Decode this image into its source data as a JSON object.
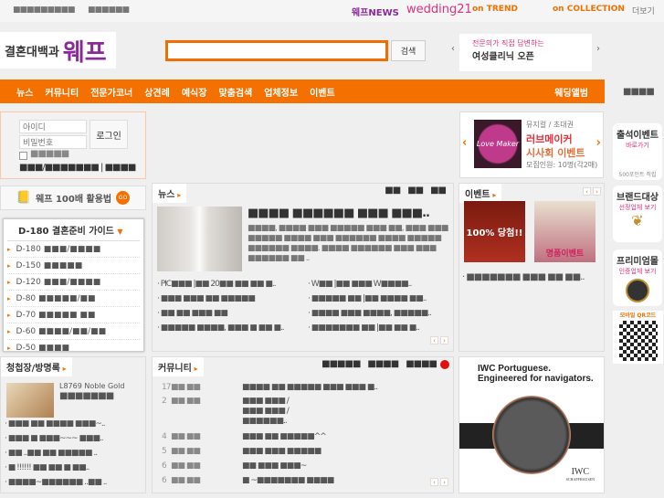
{
  "topbar": {
    "left1": "■■■■■■■■■",
    "left2": "■■■■■■",
    "links": [
      "웨프NEWS",
      "wedding21",
      "on TREND",
      "on COLLECTION"
    ],
    "more": "더보기"
  },
  "logo": {
    "text": "결혼대백과",
    "brand": "웨프"
  },
  "search": {
    "value": "",
    "button": "검색"
  },
  "banner": {
    "line1": "전문의가 직접 답변하는",
    "line2": "여성클리닉 오픈"
  },
  "nav": {
    "items": [
      "뉴스",
      "커뮤니티",
      "전문가코너",
      "상견례",
      "예식장",
      "맞춤검색",
      "업체정보",
      "이벤트"
    ],
    "album": "웨딩앨범",
    "right": "■■■■"
  },
  "login": {
    "id_placeholder": "아이디",
    "pw_placeholder": "비밀번호",
    "button": "로그인",
    "remember": "■■■■■",
    "links": "■■■/■■■■■■■ | ■■■■"
  },
  "tips": {
    "label": "웨프 100배 활용법",
    "go": "GO"
  },
  "guide": {
    "title": "D-180 결혼준비 가이드",
    "items": [
      "D-180 ■■■/■■■■",
      "D-150 ■■■■■",
      "D-120 ■■■/■■■■",
      "D-80 ■■■■■/■■",
      "D-70 ■■■■■ ■■",
      "D-60 ■■■■/■■/■■",
      "D-50 ■■■■"
    ]
  },
  "news": {
    "title": "뉴스",
    "tabs": [
      "■■",
      "■■",
      "■■"
    ],
    "headline": "■■■■ ■■■■■■ ■■■ ■■■..",
    "summary": "■■■■, ■■■■ ■■■ ■■■■■ ■■■ ■■, ■■■ ■■■ ■■■■■ ■■■■ ■■■ ■■■■■■ ■■■■ ■■■■■ ■■■■■■ ■■■■. ■■■■ ■■■■■■ ■■■ ■■■ ■■■■■■ ■■ ..",
    "left": [
      "· PIC■■■ |■■ 20■■ ■■ ■■ ■..",
      "· ■■■ ■■■ ■■ ■■■■■",
      "· ■■ ■■ ■■■ ■■",
      "· ■■■■■ ■■■■, ■■■ ■ ■■ ■.."
    ],
    "right": [
      "· W■■ |■■ ■■■ W■■■■..",
      "· ■■■■■ ■■ |■■ ■■■■ ■■..",
      "· ■■■■ ■■■ ■■■■, ■■■■■..",
      "· ■■■■■■■ ■■ |■■ ■■ ■.."
    ]
  },
  "promo": {
    "category": "뮤지컬 / 초대권",
    "title1": "러브메이커",
    "title2": "시사회 이벤트",
    "recruit": "모집인원: 10명(각2매)",
    "poster": "Love Maker"
  },
  "event": {
    "title": "이벤트",
    "img1": "100% 당첨!!",
    "img2": "명품이벤트",
    "caption": "· ■■■■■■■ ■■■ ■■ ■■.."
  },
  "side": [
    {
      "title": "출석이벤트",
      "sub": "바로가기",
      "foot": "500포인트 적립"
    },
    {
      "title": "브랜드대상",
      "sub": "선정업체 보기"
    },
    {
      "title": "프리미엄몰",
      "sub": "인증업체 보기"
    },
    {
      "title": "모바일 QR코드"
    }
  ],
  "invite": {
    "title": "청첩장/방명록",
    "product": "L8769 Noble Gold",
    "product2": "■■■■■■■",
    "items": [
      "· ■■■ ■■ ■■■■ ■■■~..",
      "· ■■■ ■ ■■■~~~ ■■■..",
      "· ■■ ..■■ ■■ ■■■■■ ..",
      "· ■ !!!!!! ■■ ■■ ■ ■■..",
      "· ■■■■~■■■■■■ ..■■ .."
    ]
  },
  "community": {
    "title": "커뮤니티",
    "tabs": [
      "■■■■■",
      "■■■■",
      "■■■■"
    ],
    "rows": [
      {
        "n": "17",
        "c": "■■ ■■",
        "t": "■■■■ ■■ ■■■■■ ■■■ ■■■ ■.."
      },
      {
        "n": "2",
        "c": "■■ ■■",
        "t": "■■■ ■■■ / ■■■ ■■■ / ■■■■■■.."
      },
      {
        "n": "4",
        "c": "■■ ■■",
        "t": "■■■ ■■ ■■■■■^^"
      },
      {
        "n": "5",
        "c": "■■ ■■",
        "t": "■■■ ■■■ ■■■■■"
      },
      {
        "n": "6",
        "c": "■■ ■■",
        "t": "■■ ■■■ ■■■~"
      },
      {
        "n": "6",
        "c": "■■ ■■",
        "t": "■ ~■■■■■■■ ■■■■"
      }
    ]
  },
  "ad": {
    "line1": "IWC Portuguese.",
    "line2": "Engineered for navigators.",
    "brand": "IWC",
    "sub": "SCHAFFHAUSEN"
  }
}
